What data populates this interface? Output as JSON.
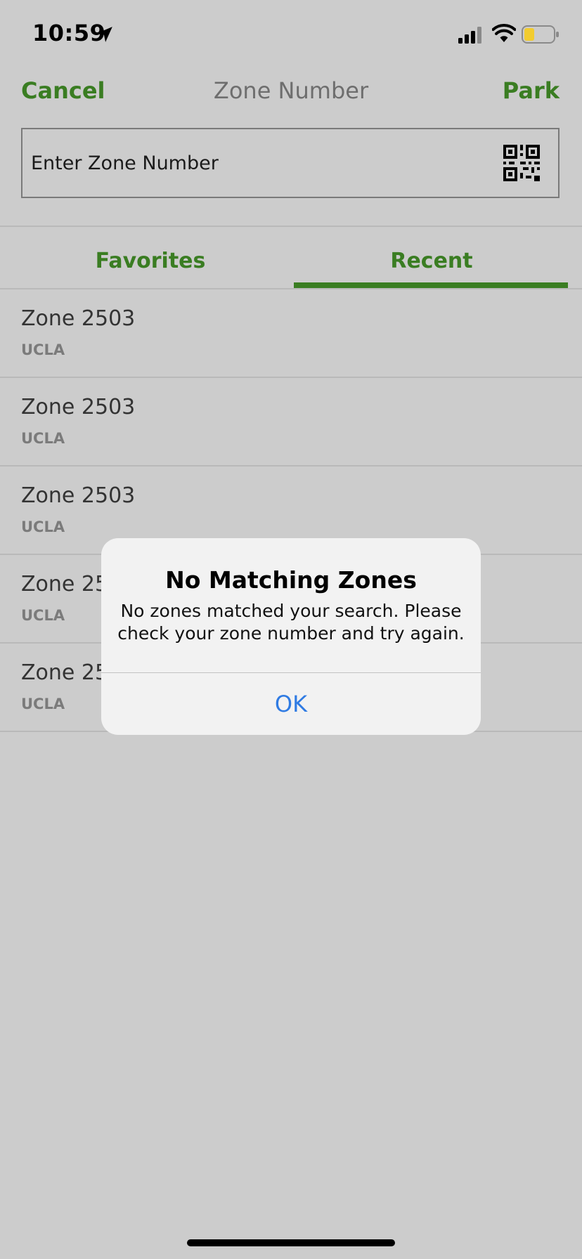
{
  "status_bar": {
    "time": "10:59",
    "location_icon": "location-arrow-icon",
    "signal_icon": "cellular-signal-icon",
    "wifi_icon": "wifi-icon",
    "battery_icon": "battery-low-icon"
  },
  "nav": {
    "cancel_label": "Cancel",
    "title": "Zone Number",
    "park_label": "Park"
  },
  "search": {
    "placeholder": "Enter Zone Number",
    "value": "",
    "scan_icon": "qr-code-icon"
  },
  "tabs": [
    {
      "label": "Favorites",
      "selected": false
    },
    {
      "label": "Recent",
      "selected": true
    }
  ],
  "list": {
    "items": [
      {
        "title": "Zone 2503",
        "subtitle": "UCLA"
      },
      {
        "title": "Zone 2503",
        "subtitle": "UCLA"
      },
      {
        "title": "Zone 2503",
        "subtitle": "UCLA"
      },
      {
        "title": "Zone 25",
        "subtitle": "UCLA"
      },
      {
        "title": "Zone 25",
        "subtitle": "UCLA"
      }
    ]
  },
  "alert": {
    "title": "No Matching Zones",
    "message": "No zones matched your search. Please check your zone number and try again.",
    "ok_label": "OK"
  },
  "colors": {
    "accent": "#3a7d22",
    "background": "#cccccc",
    "link_blue": "#2f7be3"
  }
}
